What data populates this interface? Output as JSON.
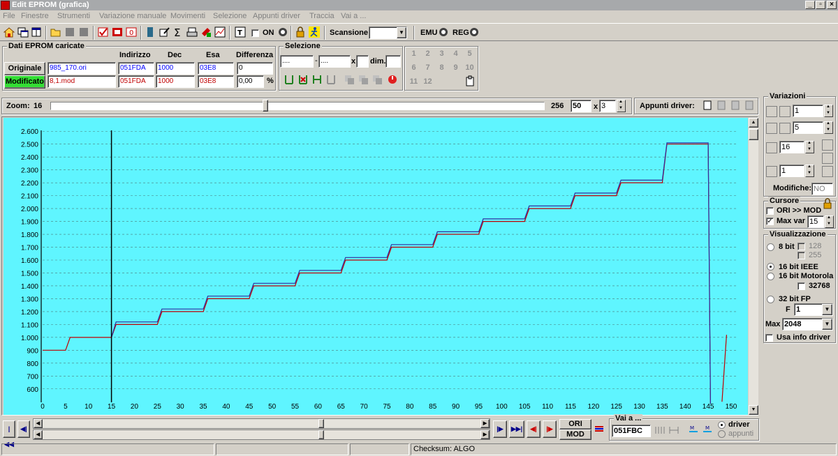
{
  "window": {
    "title": "Edit EPROM (grafica)"
  },
  "menu": [
    "File",
    "Finestre",
    "Strumenti",
    "Variazione manuale",
    "Movimenti",
    "Selezione",
    "Appunti driver",
    "Traccia",
    "Vai a ..."
  ],
  "toolbar": {
    "on_label": "ON",
    "scan_label": "Scansione",
    "scan_value": "",
    "emu_label": "EMU",
    "reg_label": "REG"
  },
  "eprom": {
    "group_label": "Dati EPROM caricate",
    "headers": {
      "address": "Indirizzo",
      "dec": "Dec",
      "hex": "Esa",
      "diff": "Differenza"
    },
    "original": {
      "label": "Originale",
      "file": "985_170.ori",
      "address": "051FDA",
      "dec": "1000",
      "hex": "03E8",
      "diff": "0"
    },
    "modified": {
      "label": "Modificato",
      "file": "8,1.mod",
      "address": "051FDA",
      "dec": "1000",
      "hex": "03E8",
      "diff": "0,00",
      "unit": "%"
    }
  },
  "selection": {
    "group_label": "Selezione",
    "from": "....",
    "to": "....",
    "x_label": "x",
    "x_value": "",
    "dim_label": "dim.",
    "dim_value": ""
  },
  "numpad": [
    "1",
    "2",
    "3",
    "4",
    "5",
    "6",
    "7",
    "8",
    "9",
    "10",
    "11",
    "12"
  ],
  "zoom": {
    "label": "Zoom:",
    "min": "16",
    "max": "256",
    "value": "50",
    "x_label": "x",
    "multiplier": "3",
    "slider_fraction": 0.44
  },
  "clipboard_driver": {
    "label": "Appunti driver:"
  },
  "variations": {
    "group_label": "Variazioni",
    "step1": "1",
    "step2": "5",
    "value3": "16",
    "value4": "1",
    "changes_label": "Modifiche:",
    "changes_value": "NO"
  },
  "cursor": {
    "group_label": "Cursore",
    "ori_mod_label": "ORI >> MOD",
    "ori_mod_checked": false,
    "maxvar_label": "Max var",
    "maxvar_checked": true,
    "maxvar_value": "15"
  },
  "display": {
    "group_label": "Visualizzazione",
    "bit8": "8 bit",
    "opt128": "128",
    "opt255": "255",
    "ieee": "16 bit IEEE",
    "motorola": "16 bit Motorola",
    "opt32768": "32768",
    "fp32": "32 bit FP",
    "f_label": "F",
    "f_value": "1",
    "max_label": "Max",
    "max_value": "2048",
    "use_driver": "Usa info driver",
    "selected": "16 bit IEEE"
  },
  "goto": {
    "label": "Vai a ...",
    "address": "051FBC",
    "driver_label": "driver",
    "clipboard_label": "appunti"
  },
  "bottom": {
    "ori_label": "ORI",
    "mod_label": "MOD"
  },
  "status": {
    "checksum": "Checksum: ALGO"
  },
  "chart_data": {
    "type": "line",
    "x_ticks": [
      "0",
      "5",
      "10",
      "15",
      "20",
      "25",
      "30",
      "35",
      "40",
      "45",
      "50",
      "55",
      "60",
      "65",
      "70",
      "75",
      "80",
      "85",
      "90",
      "95",
      "100",
      "105",
      "110",
      "115",
      "120",
      "125",
      "130",
      "135",
      "140",
      "145",
      "150"
    ],
    "y_ticks": [
      "600",
      "700",
      "800",
      "900",
      "1.000",
      "1.100",
      "1.200",
      "1.300",
      "1.400",
      "1.500",
      "1.600",
      "1.700",
      "1.800",
      "1.900",
      "2.000",
      "2.100",
      "2.200",
      "2.300",
      "2.400",
      "2.500",
      "2.600"
    ],
    "xlim": [
      0,
      150
    ],
    "ylim": [
      550,
      2650
    ],
    "grid": true,
    "cursor_x": 15,
    "series": [
      {
        "color": "#c00000",
        "points": [
          [
            0,
            900
          ],
          [
            5,
            900
          ],
          [
            6,
            1000
          ],
          [
            15,
            1000
          ],
          [
            16,
            1100
          ],
          [
            25,
            1100
          ],
          [
            26,
            1200
          ],
          [
            35,
            1200
          ],
          [
            36,
            1300
          ],
          [
            45,
            1300
          ],
          [
            46,
            1400
          ],
          [
            55,
            1400
          ],
          [
            56,
            1500
          ],
          [
            65,
            1500
          ],
          [
            66,
            1600
          ],
          [
            75,
            1600
          ],
          [
            76,
            1700
          ],
          [
            85,
            1700
          ],
          [
            86,
            1800
          ],
          [
            95,
            1800
          ],
          [
            96,
            1900
          ],
          [
            105,
            1900
          ],
          [
            106,
            2000
          ],
          [
            115,
            2000
          ],
          [
            116,
            2100
          ],
          [
            125,
            2100
          ],
          [
            126,
            2200
          ],
          [
            135,
            2200
          ],
          [
            136,
            2500
          ],
          [
            145,
            2500
          ],
          [
            145.5,
            0
          ]
        ]
      },
      {
        "color": "#3030a0",
        "points": [
          [
            15,
            1000
          ],
          [
            16,
            1120
          ],
          [
            25,
            1120
          ],
          [
            26,
            1220
          ],
          [
            35,
            1220
          ],
          [
            36,
            1320
          ],
          [
            45,
            1320
          ],
          [
            46,
            1420
          ],
          [
            55,
            1420
          ],
          [
            56,
            1520
          ],
          [
            65,
            1520
          ],
          [
            66,
            1620
          ],
          [
            75,
            1620
          ],
          [
            76,
            1720
          ],
          [
            85,
            1720
          ],
          [
            86,
            1820
          ],
          [
            95,
            1820
          ],
          [
            96,
            1920
          ],
          [
            105,
            1920
          ],
          [
            106,
            2020
          ],
          [
            115,
            2020
          ],
          [
            116,
            2120
          ],
          [
            125,
            2120
          ],
          [
            126,
            2220
          ],
          [
            135,
            2220
          ],
          [
            136,
            2510
          ],
          [
            145,
            2510
          ],
          [
            145.5,
            0
          ]
        ]
      },
      {
        "color": "#c00000",
        "points": [
          [
            148,
            500
          ],
          [
            149,
            1020
          ]
        ]
      }
    ]
  }
}
